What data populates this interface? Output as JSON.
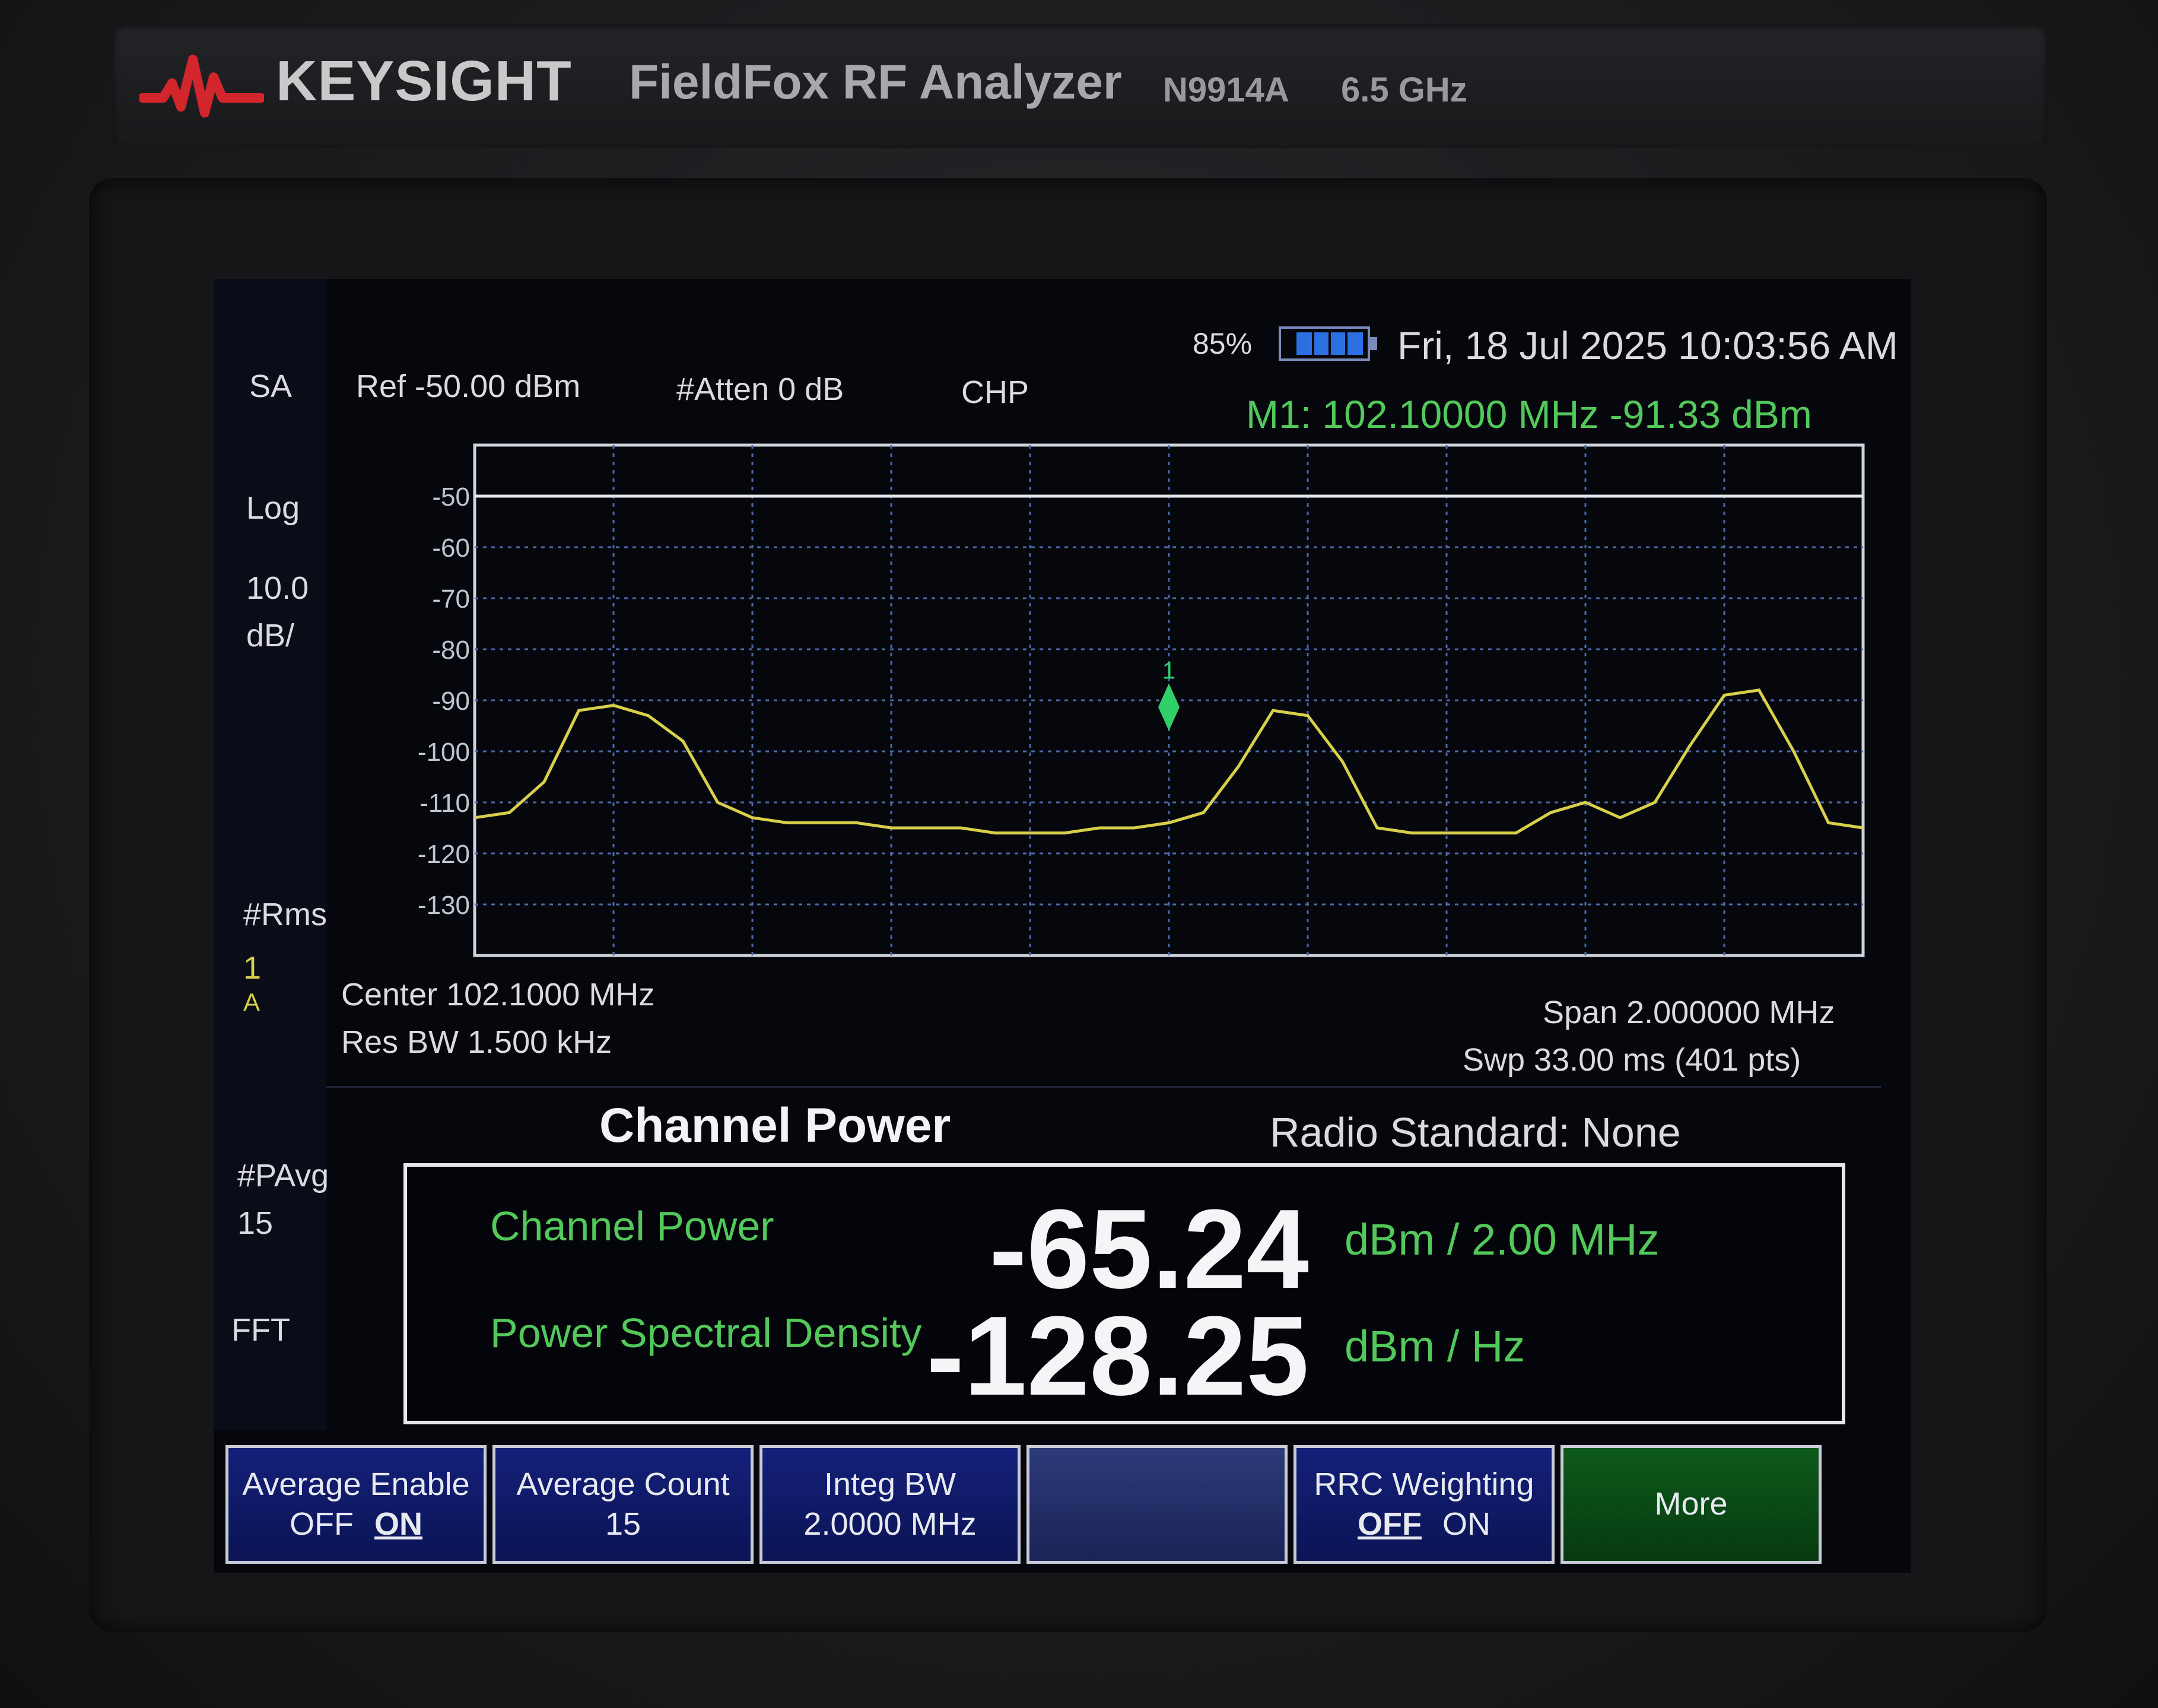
{
  "device": {
    "brand": "KEYSIGHT",
    "product": "FieldFox RF Analyzer",
    "model": "N9914A",
    "freq_range": "6.5 GHz"
  },
  "status": {
    "battery": "85%",
    "datetime": "Fri, 18 Jul 2025 10:03:56 AM"
  },
  "header": {
    "mode": "SA",
    "ref": "Ref -50.00 dBm",
    "atten": "#Atten 0 dB",
    "measurement": "CHP",
    "marker": "M1:  102.10000 MHz  -91.33 dBm"
  },
  "left_panel": {
    "scale_type": "Log",
    "scale_value": "10.0",
    "scale_unit": "dB/",
    "detector": "#Rms",
    "trace_num": "1",
    "trace_mode": "A",
    "pavg_label": "#PAvg",
    "pavg_value": "15",
    "fft": "FFT"
  },
  "footer": {
    "center": "Center 102.1000 MHz",
    "res_bw": "Res BW 1.500 kHz",
    "span": "Span 2.000000 MHz",
    "sweep": "Swp 33.00 ms (401 pts)"
  },
  "channel_power": {
    "title": "Channel Power",
    "radio_standard": "Radio Standard: None",
    "cp_label": "Channel Power",
    "cp_value": "-65.24",
    "cp_unit": "dBm / 2.00 MHz",
    "psd_label": "Power Spectral Density",
    "psd_value": "-128.25",
    "psd_unit": "dBm / Hz"
  },
  "softkeys": {
    "avg_enable_label": "Average Enable",
    "avg_enable_off": "OFF",
    "avg_enable_on": "ON",
    "avg_count_label": "Average Count",
    "avg_count_value": "15",
    "integ_bw_label": "Integ BW",
    "integ_bw_value": "2.0000 MHz",
    "rrc_label": "RRC Weighting",
    "rrc_off": "OFF",
    "rrc_on": "ON",
    "more_label": "More"
  },
  "colors": {
    "trace": "#d8cf4a",
    "marker": "#2fd06a",
    "grid": "#4a6aa8",
    "softkey": "#14207a"
  },
  "chart_data": {
    "type": "line",
    "x": [
      101.1,
      101.15,
      101.2,
      101.25,
      101.3,
      101.35,
      101.4,
      101.45,
      101.5,
      101.55,
      101.6,
      101.65,
      101.7,
      101.75,
      101.8,
      101.85,
      101.9,
      101.95,
      102.0,
      102.05,
      102.1,
      102.15,
      102.2,
      102.25,
      102.3,
      102.35,
      102.4,
      102.45,
      102.5,
      102.55,
      102.6,
      102.65,
      102.7,
      102.75,
      102.8,
      102.85,
      102.9,
      102.95,
      103.0,
      103.05,
      103.1
    ],
    "series": [
      {
        "values": [
          -113,
          -112,
          -106,
          -92,
          -91,
          -93,
          -98,
          -110,
          -113,
          -114,
          -114,
          -114,
          -115,
          -115,
          -115,
          -116,
          -116,
          -116,
          -115,
          -115,
          -114,
          -112,
          -103,
          -92,
          -93,
          -102,
          -115,
          -116,
          -116,
          -116,
          -116,
          -112,
          -110,
          -113,
          -110,
          -99,
          -89,
          -88,
          -100,
          -114,
          -115
        ]
      }
    ],
    "xlabel": "",
    "ylabel": "",
    "xlim": [
      101.1,
      103.1
    ],
    "ylim": [
      -140,
      -40
    ],
    "y_ticks": [
      -50,
      -60,
      -70,
      -80,
      -90,
      -100,
      -110,
      -120,
      -130
    ],
    "ref_line": -50,
    "marker_x": 102.1,
    "marker_y": -91.33,
    "marker_label": "1",
    "grid": true
  }
}
